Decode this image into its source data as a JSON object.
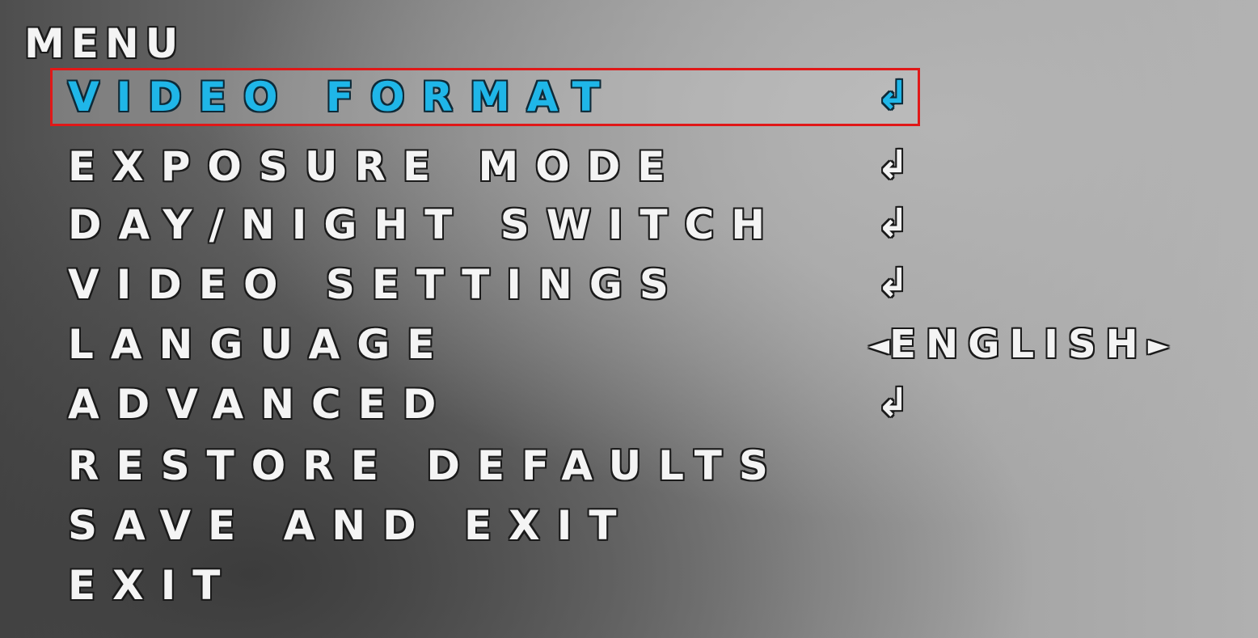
{
  "menu": {
    "title": "MENU",
    "items": [
      {
        "label": "VIDEO FORMAT",
        "indicator": "↲",
        "selected": true
      },
      {
        "label": "EXPOSURE MODE",
        "indicator": "↲"
      },
      {
        "label": "DAY/NIGHT SWITCH",
        "indicator": "↲"
      },
      {
        "label": "VIDEO SETTINGS",
        "indicator": "↲"
      },
      {
        "label": "LANGUAGE",
        "value": "ENGLISH",
        "left_arrow": "◄",
        "right_arrow": "►"
      },
      {
        "label": "ADVANCED",
        "indicator": "↲"
      },
      {
        "label": "RESTORE DEFAULTS"
      },
      {
        "label": "SAVE AND EXIT"
      },
      {
        "label": "EXIT"
      }
    ]
  },
  "colors": {
    "selected_text": "#1fb6e8",
    "selection_border": "#e01818",
    "normal_text": "#f4f4f4"
  },
  "icons": {
    "submenu": "enter-return-icon",
    "option_left": "left-triangle-icon",
    "option_right": "right-triangle-icon"
  }
}
